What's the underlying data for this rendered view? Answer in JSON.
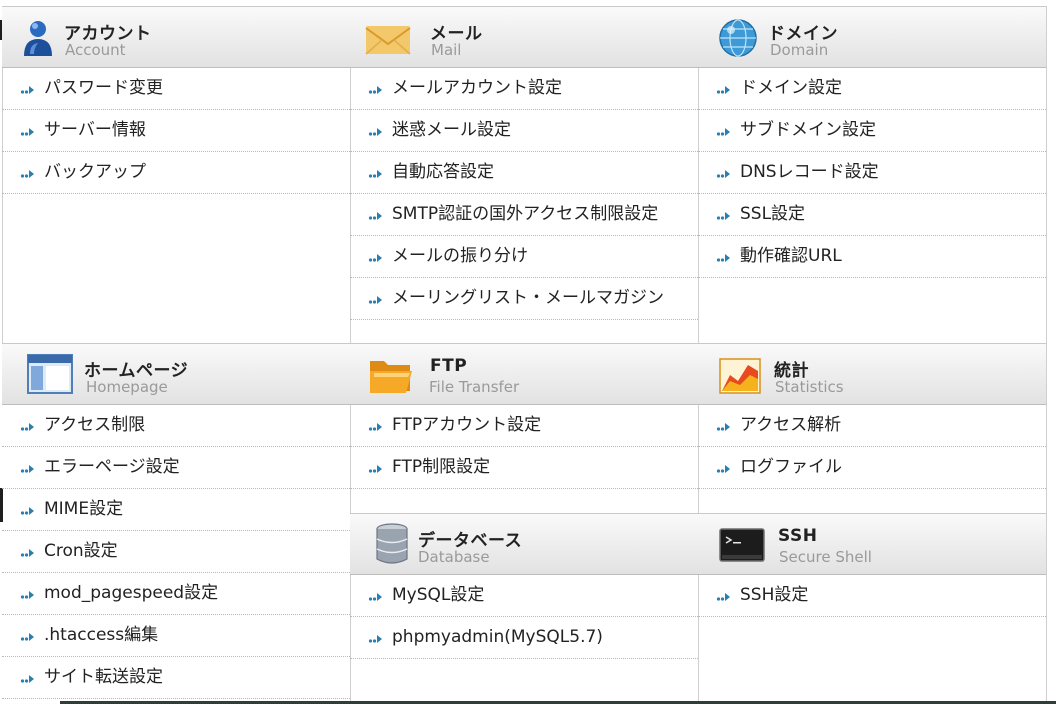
{
  "sections": {
    "account": {
      "title_jp": "アカウント",
      "title_en": "Account",
      "icon": "user-icon",
      "items": [
        "パスワード変更",
        "サーバー情報",
        "バックアップ"
      ]
    },
    "mail": {
      "title_jp": "メール",
      "title_en": "Mail",
      "icon": "envelope-icon",
      "items": [
        "メールアカウント設定",
        "迷惑メール設定",
        "自動応答設定",
        "SMTP認証の国外アクセス制限設定",
        "メールの振り分け",
        "メーリングリスト・メールマガジン"
      ]
    },
    "domain": {
      "title_jp": "ドメイン",
      "title_en": "Domain",
      "icon": "globe-icon",
      "items": [
        "ドメイン設定",
        "サブドメイン設定",
        "DNSレコード設定",
        "SSL設定",
        "動作確認URL"
      ]
    },
    "homepage": {
      "title_jp": "ホームページ",
      "title_en": "Homepage",
      "icon": "browser-window-icon",
      "items": [
        "アクセス制限",
        "エラーページ設定",
        "MIME設定",
        "Cron設定",
        "mod_pagespeed設定",
        ".htaccess編集",
        "サイト転送設定"
      ]
    },
    "ftp": {
      "title_jp": "FTP",
      "title_en": "File Transfer",
      "icon": "folder-icon",
      "items": [
        "FTPアカウント設定",
        "FTP制限設定"
      ]
    },
    "stats": {
      "title_jp": "統計",
      "title_en": "Statistics",
      "icon": "chart-icon",
      "items": [
        "アクセス解析",
        "ログファイル"
      ]
    },
    "database": {
      "title_jp": "データベース",
      "title_en": "Database",
      "icon": "database-icon",
      "items": [
        "MySQL設定",
        "phpmyadmin(MySQL5.7)"
      ]
    },
    "ssh": {
      "title_jp": "SSH",
      "title_en": "Secure Shell",
      "icon": "terminal-icon",
      "items": [
        "SSH設定"
      ]
    }
  },
  "colors": {
    "arrow": "#2a7fb0",
    "title_en": "#9a9a9a",
    "border": "#cfcfcf"
  }
}
